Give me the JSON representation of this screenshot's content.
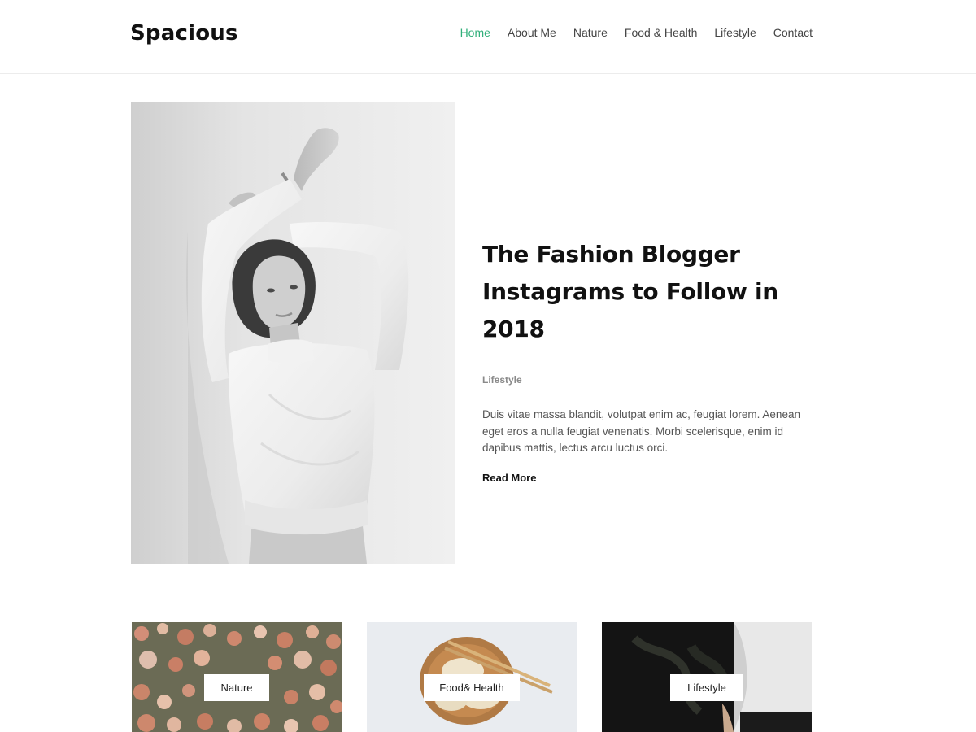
{
  "header": {
    "site_title": "Spacious",
    "nav": [
      {
        "label": "Home",
        "active": true
      },
      {
        "label": "About Me",
        "active": false
      },
      {
        "label": "Nature",
        "active": false
      },
      {
        "label": "Food & Health",
        "active": false
      },
      {
        "label": "Lifestyle",
        "active": false
      },
      {
        "label": "Contact",
        "active": false
      }
    ]
  },
  "featured": {
    "title": "The Fashion Blogger Instagrams to Follow in 2018",
    "category": "Lifestyle",
    "excerpt": "Duis vitae massa blandit, volutpat enim ac, feugiat lorem. Aenean eget eros a nulla feugiat venenatis. Morbi scelerisque, enim id dapibus mattis, lectus arcu luctus orci.",
    "read_more": "Read More"
  },
  "cards": [
    {
      "label": "Nature"
    },
    {
      "label": "Food& Health"
    },
    {
      "label": "Lifestyle"
    }
  ],
  "colors": {
    "accent": "#30af7a",
    "text_dark": "#111111",
    "text_body": "#555555",
    "text_meta": "#8a8a8a",
    "header_border": "#ececec"
  }
}
